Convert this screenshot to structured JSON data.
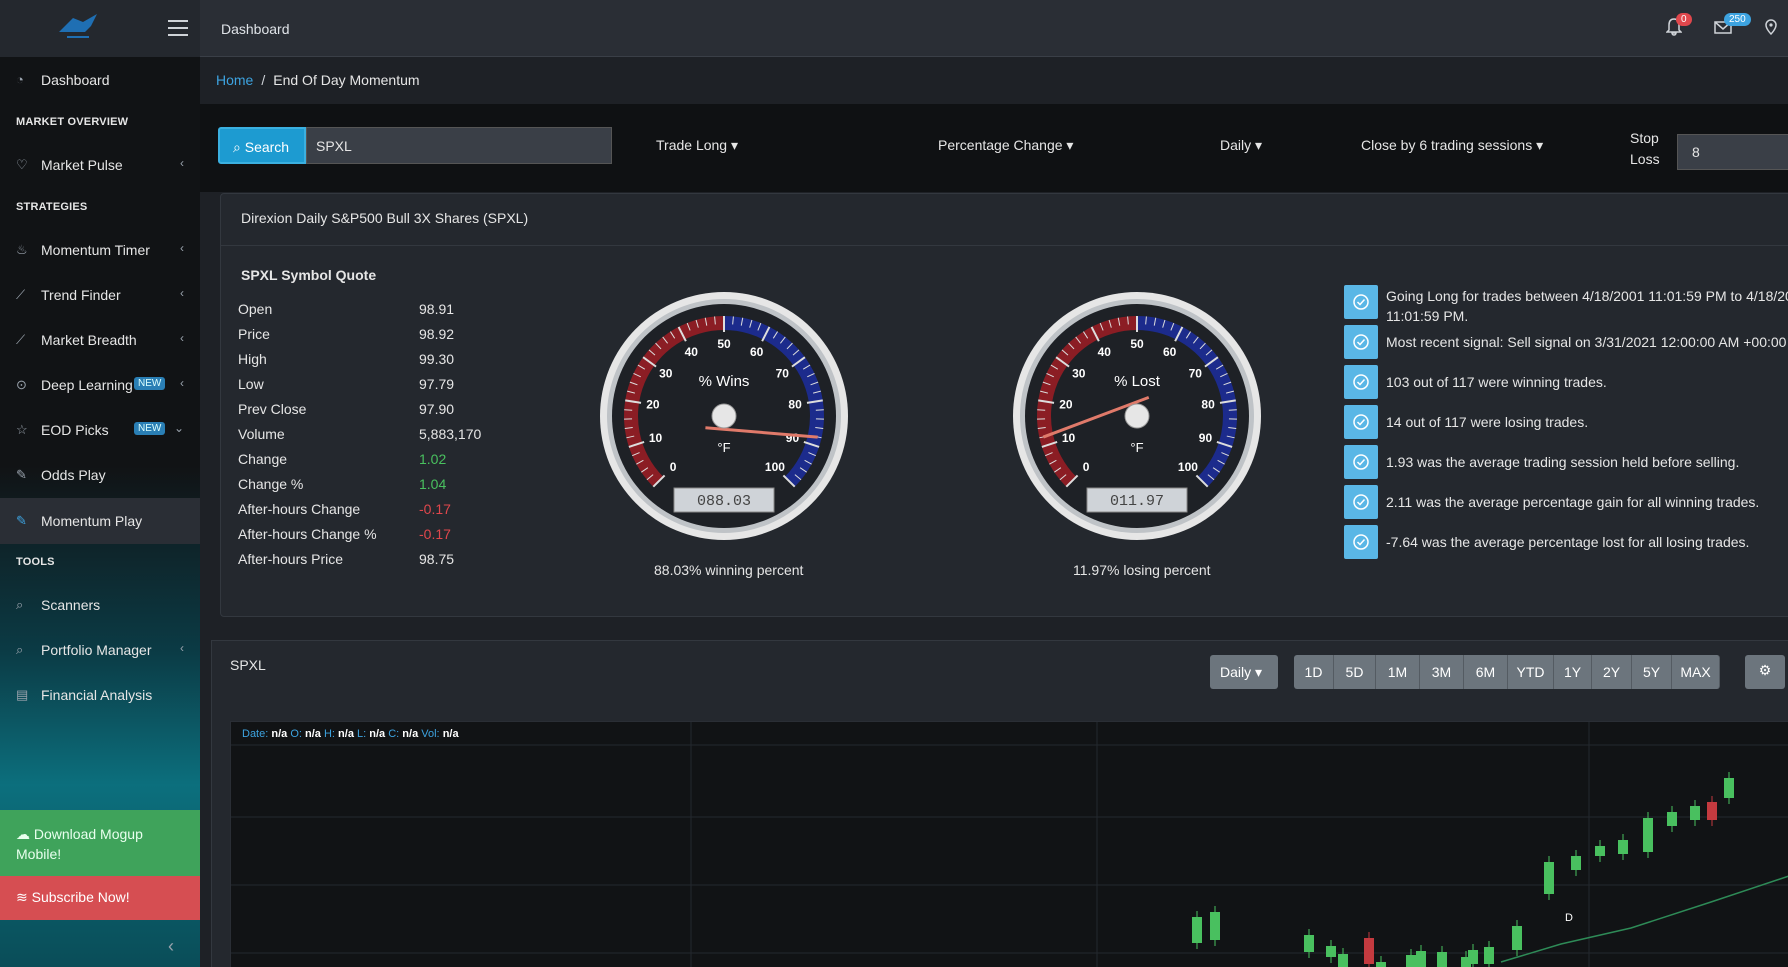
{
  "topbar": {
    "title": "Dashboard",
    "notifications_count": "0",
    "messages_count": "250"
  },
  "sidebar": {
    "items": [
      {
        "label": "Dashboard",
        "icon": "dashboard-icon"
      },
      {
        "label": "Market Pulse",
        "icon": "heart-icon"
      },
      {
        "label": "Momentum Timer",
        "icon": "fire-icon"
      },
      {
        "label": "Trend Finder",
        "icon": "line-chart-icon"
      },
      {
        "label": "Market Breadth",
        "icon": "area-chart-icon"
      },
      {
        "label": "Deep Learning",
        "icon": "brain-icon",
        "badge": "NEW"
      },
      {
        "label": "EOD Picks",
        "icon": "star-icon",
        "badge": "NEW"
      },
      {
        "label": "Odds Play",
        "icon": "pin-icon"
      },
      {
        "label": "Momentum Play",
        "icon": "pin-icon"
      },
      {
        "label": "Scanners",
        "icon": "scan-icon"
      },
      {
        "label": "Portfolio Manager",
        "icon": "portfolio-icon"
      },
      {
        "label": "Financial Analysis",
        "icon": "finance-icon"
      }
    ],
    "sections": {
      "market_overview": "MARKET OVERVIEW",
      "strategies": "STRATEGIES",
      "tools": "TOOLS"
    },
    "download_label": "Download Mogup Mobile!",
    "subscribe_label": "Subscribe Now!"
  },
  "breadcrumb": {
    "home": "Home",
    "sep": "/",
    "current": "End Of Day Momentum"
  },
  "filters": {
    "search_label": "Search",
    "search_value": "SPXL",
    "trade": "Trade Long",
    "change_type": "Percentage Change",
    "period": "Daily",
    "close_rule": "Close by 6 trading sessions",
    "stop_loss_label_1": "Stop",
    "stop_loss_label_2": "Loss",
    "stop_loss_value": "8"
  },
  "symbol_card": {
    "title": "Direxion Daily S&P500 Bull 3X Shares (SPXL)",
    "quote_title": "SPXL Symbol Quote",
    "quote": [
      {
        "label": "Open",
        "value": "98.91",
        "tone": ""
      },
      {
        "label": "Price",
        "value": "98.92",
        "tone": ""
      },
      {
        "label": "High",
        "value": "99.30",
        "tone": ""
      },
      {
        "label": "Low",
        "value": "97.79",
        "tone": ""
      },
      {
        "label": "Prev Close",
        "value": "97.90",
        "tone": ""
      },
      {
        "label": "Volume",
        "value": "5,883,170",
        "tone": ""
      },
      {
        "label": "Change",
        "value": "1.02",
        "tone": "pos"
      },
      {
        "label": "Change %",
        "value": "1.04",
        "tone": "pos"
      },
      {
        "label": "After-hours Change",
        "value": "-0.17",
        "tone": "neg"
      },
      {
        "label": "After-hours Change %",
        "value": "-0.17",
        "tone": "neg"
      },
      {
        "label": "After-hours Price",
        "value": "98.75",
        "tone": ""
      }
    ],
    "gauges": [
      {
        "title": "% Wins",
        "unit": "°F",
        "readout": "088.03",
        "value": 88.03,
        "caption": "88.03% winning percent"
      },
      {
        "title": "% Lost",
        "unit": "°F",
        "readout": "011.97",
        "value": 11.97,
        "caption": "11.97% losing percent"
      }
    ],
    "gauge_ticks": [
      "0",
      "10",
      "20",
      "30",
      "40",
      "50",
      "60",
      "70",
      "80",
      "90",
      "100"
    ],
    "stats": [
      "Going Long for trades between 4/18/2001 11:01:59 PM to 4/18/20",
      "Most recent signal: Sell signal on 3/31/2021 12:00:00 AM +00:00",
      "103 out of 117 were winning trades.",
      "14 out of 117 were losing trades.",
      "1.93 was the average trading session held before selling.",
      "2.11 was the average percentage gain for all winning trades.",
      "-7.64 was the average percentage lost for all losing trades."
    ],
    "stats_line2": "11:01:59 PM."
  },
  "chart_card": {
    "title": "SPXL",
    "interval": "Daily",
    "ranges": [
      "1D",
      "5D",
      "1M",
      "3M",
      "6M",
      "YTD",
      "1Y",
      "2Y",
      "5Y",
      "MAX"
    ],
    "ohlc": {
      "date_k": "Date:",
      "o_k": "O:",
      "h_k": "H:",
      "l_k": "L:",
      "c_k": "C:",
      "vol_k": "Vol:",
      "na": "n/a"
    },
    "marker": "D"
  }
}
